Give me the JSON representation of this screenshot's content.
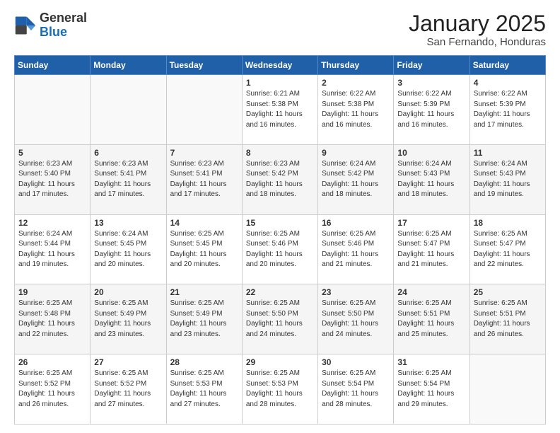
{
  "logo": {
    "general": "General",
    "blue": "Blue"
  },
  "header": {
    "month": "January 2025",
    "location": "San Fernando, Honduras"
  },
  "weekdays": [
    "Sunday",
    "Monday",
    "Tuesday",
    "Wednesday",
    "Thursday",
    "Friday",
    "Saturday"
  ],
  "weeks": [
    [
      {
        "day": "",
        "info": ""
      },
      {
        "day": "",
        "info": ""
      },
      {
        "day": "",
        "info": ""
      },
      {
        "day": "1",
        "info": "Sunrise: 6:21 AM\nSunset: 5:38 PM\nDaylight: 11 hours and 16 minutes."
      },
      {
        "day": "2",
        "info": "Sunrise: 6:22 AM\nSunset: 5:38 PM\nDaylight: 11 hours and 16 minutes."
      },
      {
        "day": "3",
        "info": "Sunrise: 6:22 AM\nSunset: 5:39 PM\nDaylight: 11 hours and 16 minutes."
      },
      {
        "day": "4",
        "info": "Sunrise: 6:22 AM\nSunset: 5:39 PM\nDaylight: 11 hours and 17 minutes."
      }
    ],
    [
      {
        "day": "5",
        "info": "Sunrise: 6:23 AM\nSunset: 5:40 PM\nDaylight: 11 hours and 17 minutes."
      },
      {
        "day": "6",
        "info": "Sunrise: 6:23 AM\nSunset: 5:41 PM\nDaylight: 11 hours and 17 minutes."
      },
      {
        "day": "7",
        "info": "Sunrise: 6:23 AM\nSunset: 5:41 PM\nDaylight: 11 hours and 17 minutes."
      },
      {
        "day": "8",
        "info": "Sunrise: 6:23 AM\nSunset: 5:42 PM\nDaylight: 11 hours and 18 minutes."
      },
      {
        "day": "9",
        "info": "Sunrise: 6:24 AM\nSunset: 5:42 PM\nDaylight: 11 hours and 18 minutes."
      },
      {
        "day": "10",
        "info": "Sunrise: 6:24 AM\nSunset: 5:43 PM\nDaylight: 11 hours and 18 minutes."
      },
      {
        "day": "11",
        "info": "Sunrise: 6:24 AM\nSunset: 5:43 PM\nDaylight: 11 hours and 19 minutes."
      }
    ],
    [
      {
        "day": "12",
        "info": "Sunrise: 6:24 AM\nSunset: 5:44 PM\nDaylight: 11 hours and 19 minutes."
      },
      {
        "day": "13",
        "info": "Sunrise: 6:24 AM\nSunset: 5:45 PM\nDaylight: 11 hours and 20 minutes."
      },
      {
        "day": "14",
        "info": "Sunrise: 6:25 AM\nSunset: 5:45 PM\nDaylight: 11 hours and 20 minutes."
      },
      {
        "day": "15",
        "info": "Sunrise: 6:25 AM\nSunset: 5:46 PM\nDaylight: 11 hours and 20 minutes."
      },
      {
        "day": "16",
        "info": "Sunrise: 6:25 AM\nSunset: 5:46 PM\nDaylight: 11 hours and 21 minutes."
      },
      {
        "day": "17",
        "info": "Sunrise: 6:25 AM\nSunset: 5:47 PM\nDaylight: 11 hours and 21 minutes."
      },
      {
        "day": "18",
        "info": "Sunrise: 6:25 AM\nSunset: 5:47 PM\nDaylight: 11 hours and 22 minutes."
      }
    ],
    [
      {
        "day": "19",
        "info": "Sunrise: 6:25 AM\nSunset: 5:48 PM\nDaylight: 11 hours and 22 minutes."
      },
      {
        "day": "20",
        "info": "Sunrise: 6:25 AM\nSunset: 5:49 PM\nDaylight: 11 hours and 23 minutes."
      },
      {
        "day": "21",
        "info": "Sunrise: 6:25 AM\nSunset: 5:49 PM\nDaylight: 11 hours and 23 minutes."
      },
      {
        "day": "22",
        "info": "Sunrise: 6:25 AM\nSunset: 5:50 PM\nDaylight: 11 hours and 24 minutes."
      },
      {
        "day": "23",
        "info": "Sunrise: 6:25 AM\nSunset: 5:50 PM\nDaylight: 11 hours and 24 minutes."
      },
      {
        "day": "24",
        "info": "Sunrise: 6:25 AM\nSunset: 5:51 PM\nDaylight: 11 hours and 25 minutes."
      },
      {
        "day": "25",
        "info": "Sunrise: 6:25 AM\nSunset: 5:51 PM\nDaylight: 11 hours and 26 minutes."
      }
    ],
    [
      {
        "day": "26",
        "info": "Sunrise: 6:25 AM\nSunset: 5:52 PM\nDaylight: 11 hours and 26 minutes."
      },
      {
        "day": "27",
        "info": "Sunrise: 6:25 AM\nSunset: 5:52 PM\nDaylight: 11 hours and 27 minutes."
      },
      {
        "day": "28",
        "info": "Sunrise: 6:25 AM\nSunset: 5:53 PM\nDaylight: 11 hours and 27 minutes."
      },
      {
        "day": "29",
        "info": "Sunrise: 6:25 AM\nSunset: 5:53 PM\nDaylight: 11 hours and 28 minutes."
      },
      {
        "day": "30",
        "info": "Sunrise: 6:25 AM\nSunset: 5:54 PM\nDaylight: 11 hours and 28 minutes."
      },
      {
        "day": "31",
        "info": "Sunrise: 6:25 AM\nSunset: 5:54 PM\nDaylight: 11 hours and 29 minutes."
      },
      {
        "day": "",
        "info": ""
      }
    ]
  ]
}
